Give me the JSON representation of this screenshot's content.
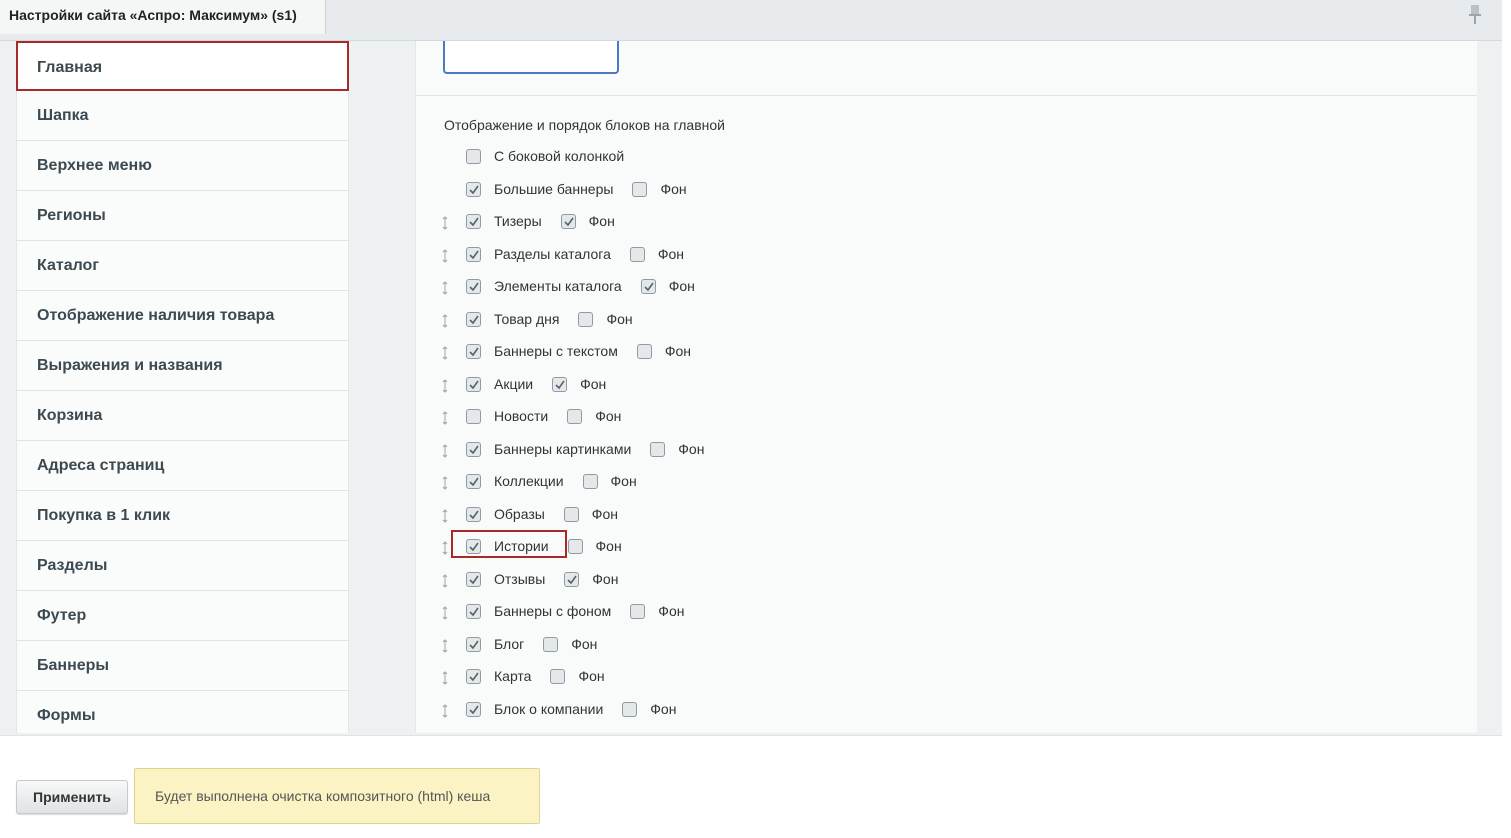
{
  "window": {
    "tab_title": "Настройки сайта «Аспро: Максимум» (s1)"
  },
  "sidebar": {
    "items": [
      {
        "label": "Главная",
        "active": true
      },
      {
        "label": "Шапка"
      },
      {
        "label": "Верхнее меню"
      },
      {
        "label": "Регионы"
      },
      {
        "label": "Каталог"
      },
      {
        "label": "Отображение наличия товара"
      },
      {
        "label": "Выражения и названия"
      },
      {
        "label": "Корзина"
      },
      {
        "label": "Адреса страниц"
      },
      {
        "label": "Покупка в 1 клик"
      },
      {
        "label": "Разделы"
      },
      {
        "label": "Футер"
      },
      {
        "label": "Баннеры"
      },
      {
        "label": "Формы"
      }
    ]
  },
  "content": {
    "section_title": "Отображение и порядок блоков на главной",
    "fon_label": "Фон",
    "blocks": [
      {
        "label": "С боковой колонкой",
        "checked": false,
        "draggable": false,
        "has_fon": false
      },
      {
        "label": "Большие баннеры",
        "checked": true,
        "draggable": false,
        "has_fon": true,
        "fon": false
      },
      {
        "label": "Тизеры",
        "checked": true,
        "draggable": true,
        "has_fon": true,
        "fon": true
      },
      {
        "label": "Разделы каталога",
        "checked": true,
        "draggable": true,
        "has_fon": true,
        "fon": false
      },
      {
        "label": "Элементы каталога",
        "checked": true,
        "draggable": true,
        "has_fon": true,
        "fon": true
      },
      {
        "label": "Товар дня",
        "checked": true,
        "draggable": true,
        "has_fon": true,
        "fon": false
      },
      {
        "label": "Баннеры с текстом",
        "checked": true,
        "draggable": true,
        "has_fon": true,
        "fon": false
      },
      {
        "label": "Акции",
        "checked": true,
        "draggable": true,
        "has_fon": true,
        "fon": true
      },
      {
        "label": "Новости",
        "checked": false,
        "draggable": true,
        "has_fon": true,
        "fon": false
      },
      {
        "label": "Баннеры картинками",
        "checked": true,
        "draggable": true,
        "has_fon": true,
        "fon": false
      },
      {
        "label": "Коллекции",
        "checked": true,
        "draggable": true,
        "has_fon": true,
        "fon": false
      },
      {
        "label": "Образы",
        "checked": true,
        "draggable": true,
        "has_fon": true,
        "fon": false
      },
      {
        "label": "Истории",
        "checked": true,
        "draggable": true,
        "has_fon": true,
        "fon": false,
        "highlighted": true
      },
      {
        "label": "Отзывы",
        "checked": true,
        "draggable": true,
        "has_fon": true,
        "fon": true
      },
      {
        "label": "Баннеры с фоном",
        "checked": true,
        "draggable": true,
        "has_fon": true,
        "fon": false
      },
      {
        "label": "Блог",
        "checked": true,
        "draggable": true,
        "has_fon": true,
        "fon": false
      },
      {
        "label": "Карта",
        "checked": true,
        "draggable": true,
        "has_fon": true,
        "fon": false
      },
      {
        "label": "Блок о компании",
        "checked": true,
        "draggable": true,
        "has_fon": true,
        "fon": false
      }
    ]
  },
  "footer": {
    "apply_label": "Применить",
    "notice": "Будет выполнена очистка композитного (html) кеша"
  },
  "colors": {
    "highlight": "#a62a2a",
    "input_border": "#4b79c4",
    "notice_bg": "#fbf3c4"
  }
}
